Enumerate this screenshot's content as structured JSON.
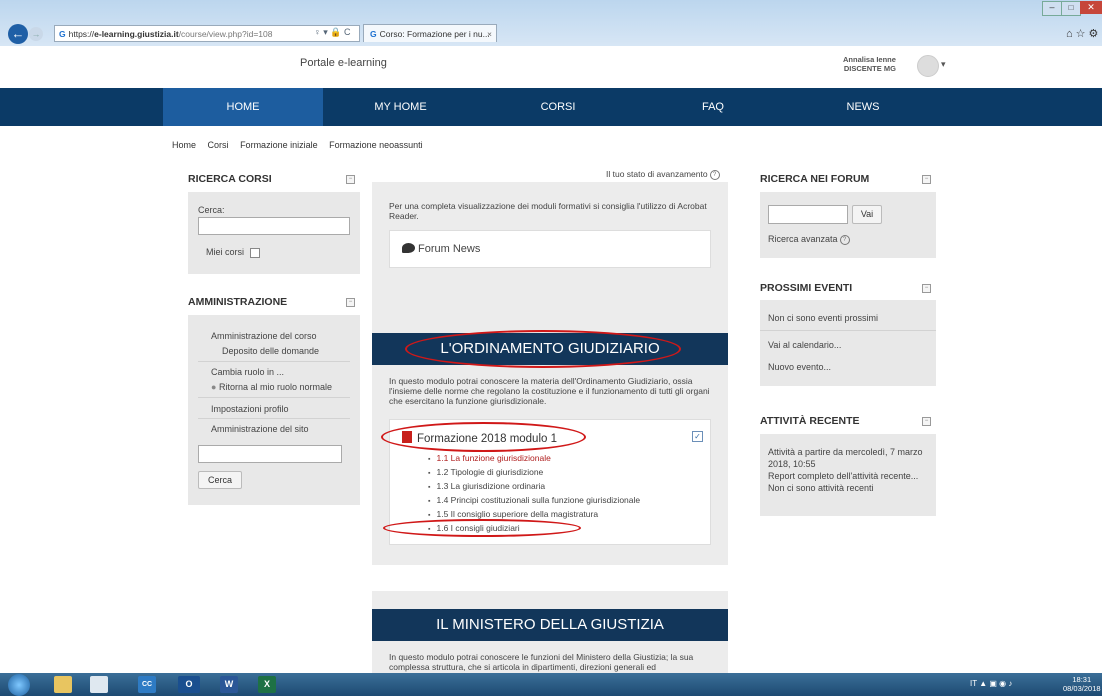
{
  "browser": {
    "url_prefix": "https://",
    "url_host": "e-learning.giustizia.it",
    "url_path": "/course/view.php?id=108",
    "tab_title": "Corso: Formazione per i nu...",
    "favicon_letter": "G",
    "tab_close": "×",
    "addr_controls": "♀ ▾ 🔒 C"
  },
  "site": {
    "title": "Portale e-learning",
    "user_name": "Annalisa Ienne",
    "user_role": "DISCENTE MG"
  },
  "nav": [
    "HOME",
    "MY HOME",
    "CORSI",
    "FAQ",
    "NEWS"
  ],
  "breadcrumb": [
    "Home",
    "Corsi",
    "Formazione iniziale",
    "Formazione neoassunti"
  ],
  "left": {
    "ricerca_title": "RICERCA CORSI",
    "cerca_label": "Cerca:",
    "miei_corsi": "Miei corsi",
    "admin_title": "AMMINISTRAZIONE",
    "admin_items": [
      "Amministrazione del corso",
      "Deposito delle domande",
      "Cambia ruolo in ...",
      "Ritorna al mio ruolo normale",
      "Impostazioni profilo",
      "Amministrazione del sito"
    ],
    "cerca_button": "Cerca"
  },
  "center": {
    "progress_label": "Il tuo stato di avanzamento",
    "acrobat_note": "Per una completa visualizzazione dei moduli formativi si consiglia l'utilizzo di Acrobat Reader.",
    "forum_news": "Forum News",
    "section1_title": "L'ORDINAMENTO GIUDIZIARIO",
    "section1_desc": "In questo modulo potrai conoscere la materia dell'Ordinamento Giudiziario, ossia l'insieme delle norme che regolano la costituzione e il funzionamento di tutti gli organi che esercitano la funzione giurisdizionale.",
    "module_title": "Formazione 2018 modulo 1",
    "module_items": [
      "1.1 La funzione giurisdizionale",
      "1.2 Tipologie di giurisdizione",
      "1.3 La giurisdizione ordinaria",
      "1.4 Principi costituzionali sulla funzione giurisdizionale",
      "1.5 Il consiglio superiore della magistratura",
      "1.6 I consigli giudiziari"
    ],
    "section2_title": "IL MINISTERO DELLA GIUSTIZIA",
    "section2_desc": "In questo modulo potrai conoscere le funzioni del Ministero della Giustizia; la sua complessa struttura, che si articola in dipartimenti, direzioni generali ed"
  },
  "right": {
    "forum_title": "RICERCA NEI FORUM",
    "vai": "Vai",
    "ricerca_avanzata": "Ricerca avanzata",
    "eventi_title": "PROSSIMI EVENTI",
    "no_eventi": "Non ci sono eventi prossimi",
    "calendario": "Vai al calendario...",
    "nuovo_evento": "Nuovo evento...",
    "attivita_title": "ATTIVITÀ RECENTE",
    "attivita_da": "Attività a partire da mercoledì, 7 marzo 2018, 10:55",
    "report": "Report completo dell'attività recente...",
    "no_attivita": "Non ci sono attività recenti"
  },
  "taskbar": {
    "lang": "IT",
    "time": "18:31",
    "date": "08/03/2018",
    "apps": [
      "CC",
      "O",
      "W",
      "X"
    ]
  },
  "colors": {
    "nav_bg": "#0b3a66",
    "nav_active": "#1d5d9f",
    "section_header": "#12365a",
    "annotation_red": "#d01818"
  }
}
